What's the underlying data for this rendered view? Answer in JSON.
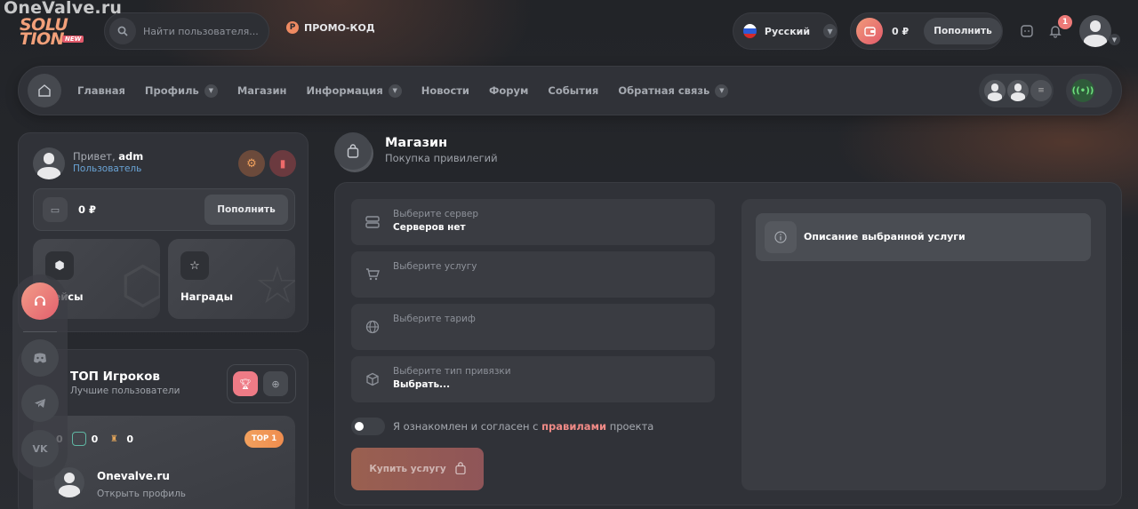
{
  "watermark": "OneValve.ru",
  "logo": {
    "line1": "SOLU",
    "line2": "TION",
    "tag": "NEW"
  },
  "search": {
    "placeholder": "Найти пользователя..."
  },
  "promo": {
    "label": "ПРОМО-КОД",
    "icon_letter": "P"
  },
  "language": {
    "label": "Русский"
  },
  "wallet": {
    "balance": "0 ₽",
    "topup_label": "Пополнить"
  },
  "notifications": {
    "count": "1"
  },
  "nav": {
    "items": [
      {
        "label": "Главная"
      },
      {
        "label": "Профиль"
      },
      {
        "label": "Магазин"
      },
      {
        "label": "Информация"
      },
      {
        "label": "Новости"
      },
      {
        "label": "Форум"
      },
      {
        "label": "События"
      },
      {
        "label": "Обратная связь"
      }
    ],
    "radio_label": "((•))"
  },
  "profile": {
    "greeting": "Привет,",
    "username": "adm",
    "role": "Пользователь",
    "balance": "0 ₽",
    "topup_label": "Пополнить",
    "cards": [
      {
        "label": "Кейсы"
      },
      {
        "label": "Награды"
      }
    ]
  },
  "top_players": {
    "title": "ТОП Игроков",
    "subtitle": "Лучшие пользователи",
    "stats": [
      "0",
      "0",
      "0"
    ],
    "badge": "TOP 1",
    "player_name": "Onevalve.ru",
    "open_profile": "Открыть профиль"
  },
  "shop": {
    "title": "Магазин",
    "subtitle": "Покупка привилегий",
    "fields": [
      {
        "label": "Выберите сервер",
        "value": "Серверов нет"
      },
      {
        "label": "Выберите услугу",
        "value": ""
      },
      {
        "label": "Выберите тариф",
        "value": ""
      },
      {
        "label": "Выберите тип привязки",
        "value": "Выбрать..."
      }
    ],
    "agree_prefix": "Я ознакомлен и согласен с",
    "agree_link": "правилами",
    "agree_suffix": "проекта",
    "buy_label": "Купить услугу",
    "description_title": "Описание выбранной услуги"
  },
  "colors": {
    "accent": "#ee7a78",
    "brand": "#f2a07a",
    "online": "#6ee07e"
  }
}
